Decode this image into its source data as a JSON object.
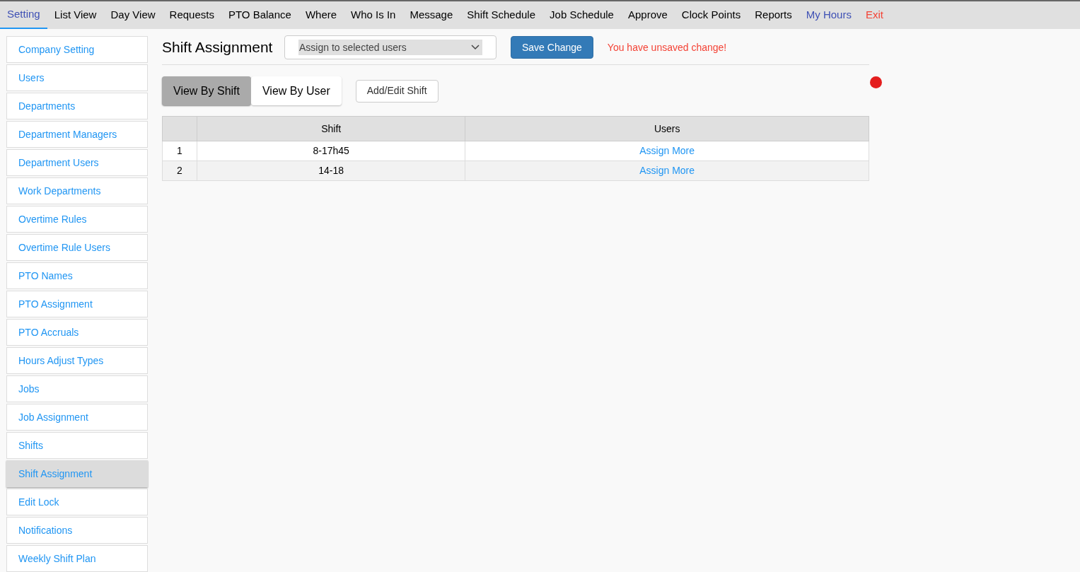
{
  "nav": [
    {
      "label": "Setting",
      "kind": "normal",
      "selected": true
    },
    {
      "label": "List View",
      "kind": "normal",
      "selected": false
    },
    {
      "label": "Day View",
      "kind": "normal",
      "selected": false
    },
    {
      "label": "Requests",
      "kind": "normal",
      "selected": false
    },
    {
      "label": "PTO Balance",
      "kind": "normal",
      "selected": false
    },
    {
      "label": "Where",
      "kind": "normal",
      "selected": false
    },
    {
      "label": "Who Is In",
      "kind": "normal",
      "selected": false
    },
    {
      "label": "Message",
      "kind": "normal",
      "selected": false
    },
    {
      "label": "Shift Schedule",
      "kind": "normal",
      "selected": false
    },
    {
      "label": "Job Schedule",
      "kind": "normal",
      "selected": false
    },
    {
      "label": "Approve",
      "kind": "normal",
      "selected": false
    },
    {
      "label": "Clock Points",
      "kind": "normal",
      "selected": false
    },
    {
      "label": "Reports",
      "kind": "normal",
      "selected": false
    },
    {
      "label": "My Hours",
      "kind": "personal",
      "selected": false
    },
    {
      "label": "Exit",
      "kind": "exit",
      "selected": false
    }
  ],
  "sidebar": {
    "items": [
      {
        "label": "Company Setting",
        "selected": false
      },
      {
        "label": "Users",
        "selected": false
      },
      {
        "label": "Departments",
        "selected": false
      },
      {
        "label": "Department Managers",
        "selected": false
      },
      {
        "label": "Department Users",
        "selected": false
      },
      {
        "label": "Work Departments",
        "selected": false
      },
      {
        "label": "Overtime Rules",
        "selected": false
      },
      {
        "label": "Overtime Rule Users",
        "selected": false
      },
      {
        "label": "PTO Names",
        "selected": false
      },
      {
        "label": "PTO Assignment",
        "selected": false
      },
      {
        "label": "PTO Accruals",
        "selected": false
      },
      {
        "label": "Hours Adjust Types",
        "selected": false
      },
      {
        "label": "Jobs",
        "selected": false
      },
      {
        "label": "Job Assignment",
        "selected": false
      },
      {
        "label": "Shifts",
        "selected": false
      },
      {
        "label": "Shift Assignment",
        "selected": true
      },
      {
        "label": "Edit Lock",
        "selected": false
      },
      {
        "label": "Notifications",
        "selected": false
      },
      {
        "label": "Weekly Shift Plan",
        "selected": false
      }
    ]
  },
  "header": {
    "title": "Shift Assignment",
    "mode_select": {
      "value": "Assign to selected users"
    },
    "save_button": "Save Change",
    "warning": "You have unsaved change!"
  },
  "view_tabs": [
    {
      "label": "View By Shift",
      "selected": true
    },
    {
      "label": "View By User",
      "selected": false
    }
  ],
  "add_edit_button": "Add/Edit Shift",
  "table": {
    "columns": [
      "Shift",
      "Users"
    ],
    "rows": [
      {
        "number": "1",
        "shift": "8-17h45",
        "users_link": "Assign More"
      },
      {
        "number": "2",
        "shift": "14-18",
        "users_link": "Assign More"
      }
    ]
  }
}
